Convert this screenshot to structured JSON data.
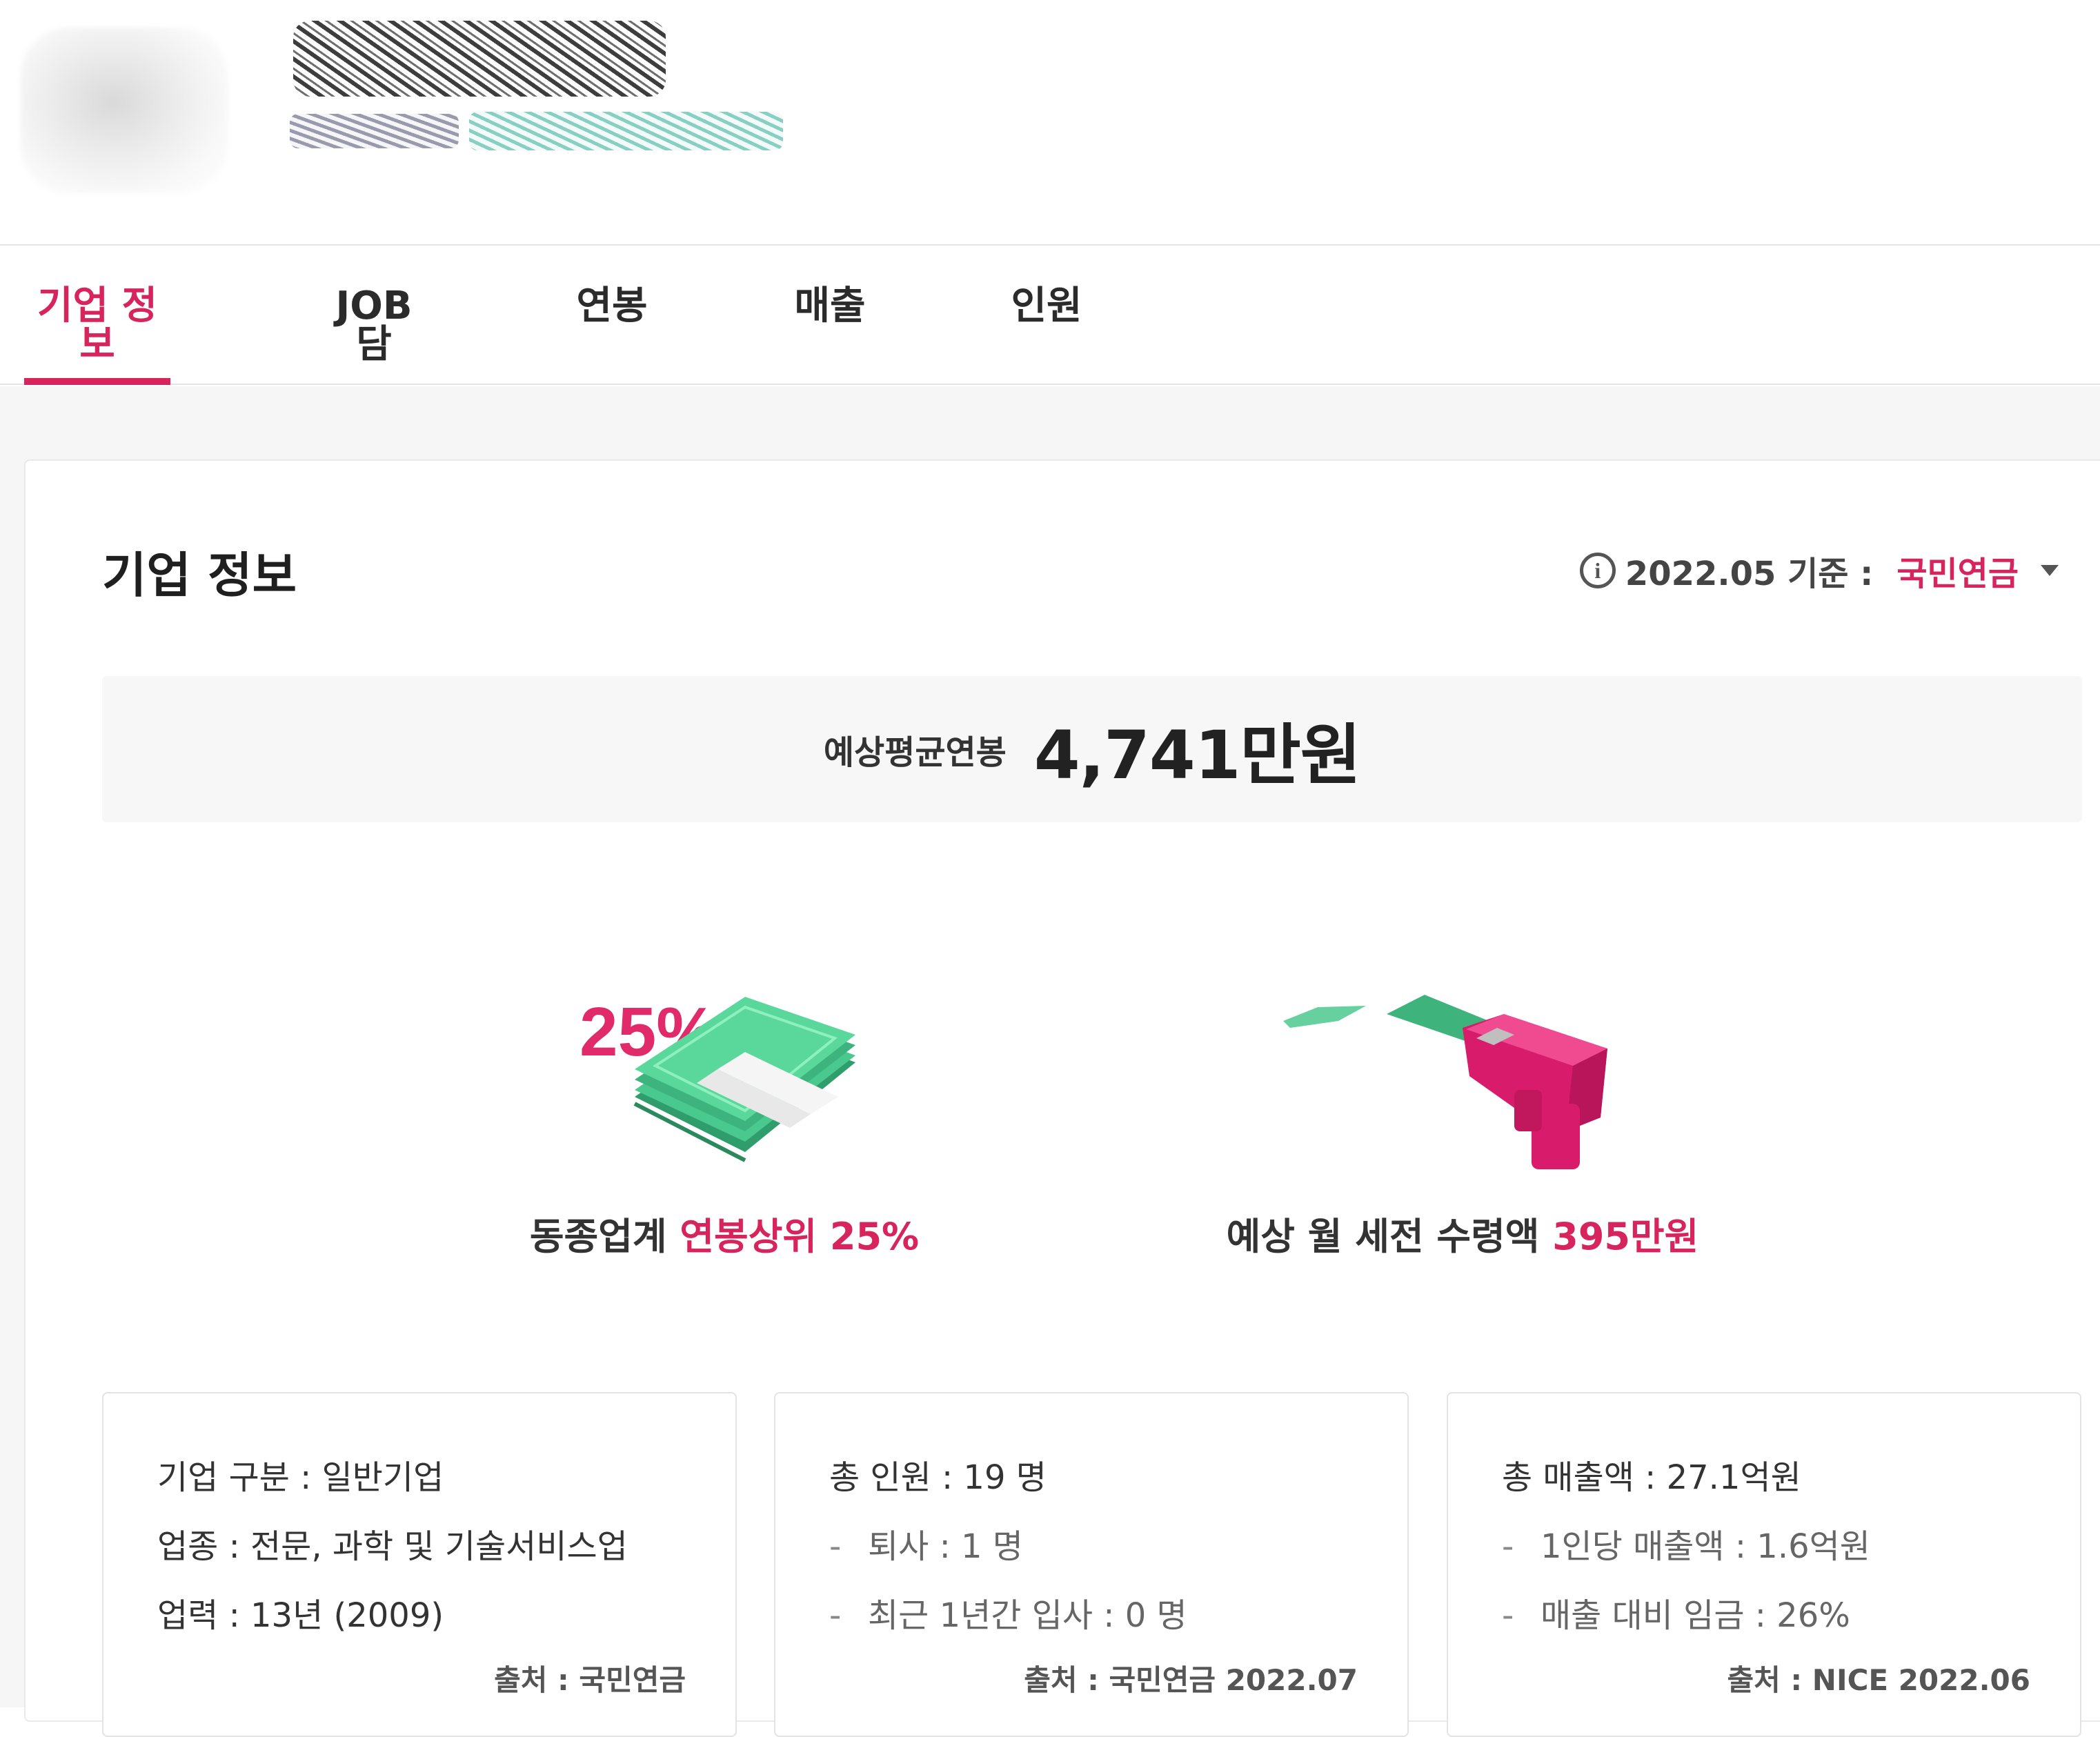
{
  "tabs": [
    {
      "label": "기업 정보"
    },
    {
      "label": "JOB담"
    },
    {
      "label": "연봉"
    },
    {
      "label": "매출"
    },
    {
      "label": "인원"
    }
  ],
  "section": {
    "title": "기업 정보",
    "basis_label": "2022.05 기준 :",
    "basis_value": "국민연금"
  },
  "salary": {
    "label": "예상평균연봉",
    "value": "4,741만원"
  },
  "highlights": [
    {
      "text": "동종업계",
      "highlight": "연봉상위 25%",
      "illustration_text": "25%"
    },
    {
      "text": "예상 월 세전 수령액",
      "highlight": "395만원"
    }
  ],
  "info_cards": [
    {
      "lines": [
        "기업 구분 : 일반기업",
        "업종 : 전문, 과학 및 기술서비스업",
        "업력 : 13년 (2009)"
      ],
      "source": "출처 : 국민연금"
    },
    {
      "lines": [
        "총 인원 : 19 명",
        "퇴사 : 1 명",
        "최근 1년간 입사 : 0 명"
      ],
      "source": "출처 : 국민연금 2022.07"
    },
    {
      "lines": [
        "총 매출액 : 27.1억원",
        "1인당 매출액 : 1.6억원",
        "매출 대비 임금 : 26%"
      ],
      "source": "출처 : NICE 2022.06"
    }
  ],
  "colors": {
    "accent": "#d8245c",
    "money_green": "#3ec98e",
    "gun_pink": "#e91e78"
  }
}
